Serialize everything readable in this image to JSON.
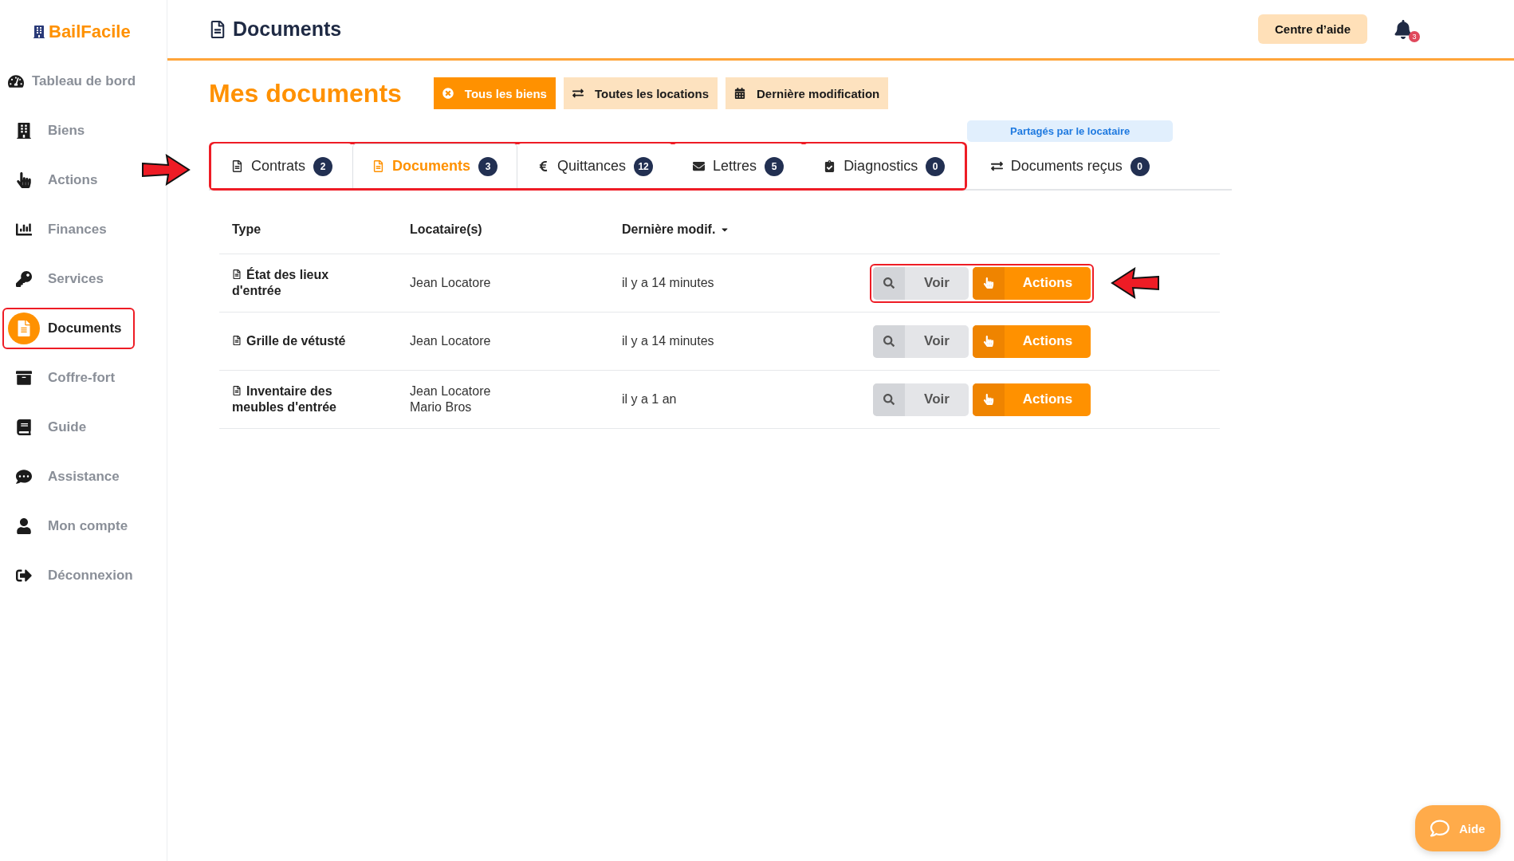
{
  "logo": {
    "text": "BailFacile"
  },
  "sidebar": {
    "items": [
      {
        "label": "Tableau de bord",
        "selected": false,
        "highlighted": false
      },
      {
        "label": "Biens",
        "selected": false,
        "highlighted": false
      },
      {
        "label": "Actions",
        "selected": false,
        "highlighted": false
      },
      {
        "label": "Finances",
        "selected": false,
        "highlighted": false
      },
      {
        "label": "Services",
        "selected": false,
        "highlighted": false
      },
      {
        "label": "Documents",
        "selected": true,
        "highlighted": true
      },
      {
        "label": "Coffre-fort",
        "selected": false,
        "highlighted": false
      },
      {
        "label": "Guide",
        "selected": false,
        "highlighted": false
      },
      {
        "label": "Assistance",
        "selected": false,
        "highlighted": false
      },
      {
        "label": "Mon compte",
        "selected": false,
        "highlighted": false
      },
      {
        "label": "Déconnexion",
        "selected": false,
        "highlighted": false
      }
    ]
  },
  "header": {
    "title": "Documents",
    "help_button": "Centre d’aide",
    "notification_count": "3"
  },
  "page_title": "Mes documents",
  "filters": [
    {
      "label": "Tous les biens",
      "selected": true
    },
    {
      "label": "Toutes les locations",
      "selected": false
    },
    {
      "label": "Dernière modification",
      "selected": false
    }
  ],
  "tabs_arrow": true,
  "tab_groups": [
    {
      "highlighted": true,
      "tabs": [
        {
          "label": "Contrats",
          "count": "2",
          "selected": false
        },
        {
          "label": "Documents",
          "count": "3",
          "selected": true
        },
        {
          "label": "Quittances",
          "count": "12",
          "selected": false
        },
        {
          "label": "Lettres",
          "count": "5",
          "selected": false
        },
        {
          "label": "Diagnostics",
          "count": "0",
          "selected": false
        }
      ]
    },
    {
      "highlighted": false,
      "label": "Partagés par le locataire",
      "tabs": [
        {
          "label": "Documents reçus",
          "count": "0",
          "selected": false
        }
      ]
    }
  ],
  "table": {
    "columns": [
      "Type",
      "Locataire(s)",
      "Dernière modif."
    ],
    "rows": [
      {
        "type": "État des lieux d'entrée",
        "tenants": [
          "Jean Locatore"
        ],
        "modified": "il y a 14 minutes",
        "view": "Voir",
        "actions": "Actions",
        "highlighted": true,
        "arrow": true
      },
      {
        "type": "Grille de vétusté",
        "tenants": [
          "Jean Locatore"
        ],
        "modified": "il y a 14 minutes",
        "view": "Voir",
        "actions": "Actions",
        "highlighted": false,
        "arrow": false
      },
      {
        "type": "Inventaire des meubles d'entrée",
        "tenants": [
          "Jean Locatore",
          "Mario Bros"
        ],
        "modified": "il y a 1 an",
        "view": "Voir",
        "actions": "Actions",
        "highlighted": false,
        "arrow": false
      }
    ]
  },
  "help_widget": {
    "label": "Aide"
  }
}
